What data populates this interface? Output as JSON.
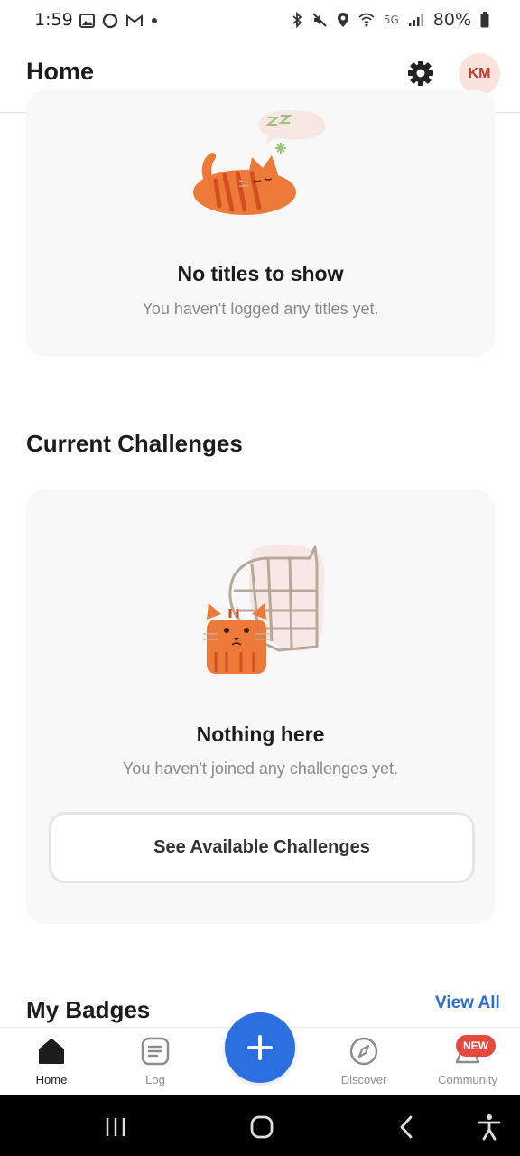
{
  "status": {
    "time": "1:59",
    "network": "5G",
    "battery": "80%"
  },
  "header": {
    "title": "Home",
    "avatar_initials": "KM"
  },
  "titles_card": {
    "title": "No titles to show",
    "subtitle": "You haven't logged any titles yet.",
    "illustration": "sleeping-cat-illustration"
  },
  "challenges": {
    "section_title": "Current Challenges",
    "empty_title": "Nothing here",
    "empty_subtitle": "You haven't joined any challenges yet.",
    "button_label": "See Available Challenges",
    "illustration": "cat-with-net-illustration"
  },
  "badges": {
    "section_title": "My Badges",
    "view_all": "View All"
  },
  "bottom_nav": {
    "items": [
      {
        "label": "Home",
        "icon": "home-icon",
        "active": true
      },
      {
        "label": "Log",
        "icon": "log-icon",
        "active": false
      },
      {
        "label": "Discover",
        "icon": "compass-icon",
        "active": false
      },
      {
        "label": "Community",
        "icon": "community-icon",
        "active": false,
        "badge": "NEW"
      }
    ],
    "fab_icon": "plus-icon"
  },
  "colors": {
    "accent": "#2b6fe0",
    "link": "#2d6bd6",
    "badge_red": "#e8493f",
    "cat_orange": "#ee7a3a",
    "card_bg": "#f8f8f8"
  }
}
